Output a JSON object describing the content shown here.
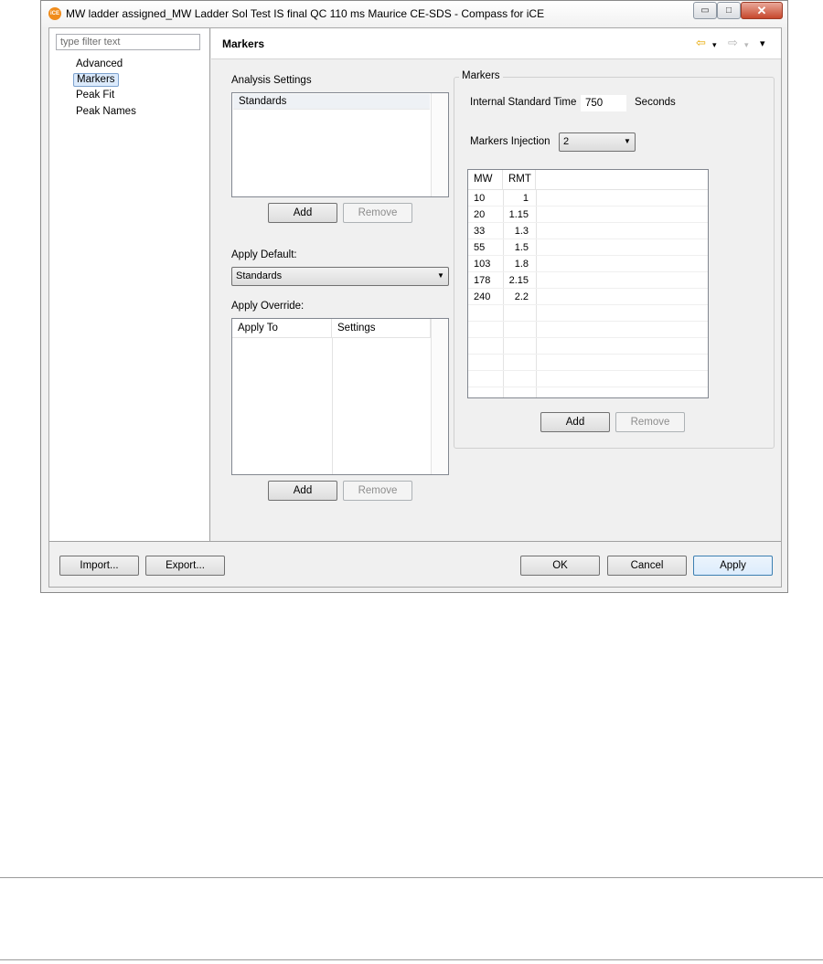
{
  "window": {
    "title": "MW ladder assigned_MW Ladder Sol Test IS final QC 110 ms Maurice CE-SDS - Compass for iCE",
    "app_icon_text": "iCE",
    "minimize": "▭",
    "maximize": "□",
    "close": "✕"
  },
  "sidebar": {
    "filter_placeholder": "type filter text",
    "items": [
      {
        "label": "Advanced",
        "selected": false
      },
      {
        "label": "Markers",
        "selected": true
      },
      {
        "label": "Peak Fit",
        "selected": false
      },
      {
        "label": "Peak Names",
        "selected": false
      }
    ]
  },
  "page": {
    "title": "Markers",
    "nav": {
      "back": "⇦",
      "forward": "⇨",
      "dropdown": "▾",
      "menu": "▾",
      "back_color": "#e8a800",
      "forward_color": "#b8b8b8"
    }
  },
  "analysis": {
    "label": "Analysis Settings",
    "items": [
      "Standards"
    ],
    "add": "Add",
    "remove": "Remove",
    "apply_default_label": "Apply Default:",
    "apply_default_value": "Standards",
    "apply_override_label": "Apply Override:",
    "override_columns": [
      "Apply To",
      "Settings"
    ],
    "override_add": "Add",
    "override_remove": "Remove"
  },
  "markers": {
    "group_label": "Markers",
    "internal_std_label": "Internal Standard Time",
    "internal_std_value": "750",
    "internal_std_unit": "Seconds",
    "injection_label": "Markers Injection",
    "injection_value": "2",
    "columns": [
      "MW",
      "RMT"
    ],
    "rows": [
      {
        "mw": "10",
        "rmt": "1"
      },
      {
        "mw": "20",
        "rmt": "1.15"
      },
      {
        "mw": "33",
        "rmt": "1.3"
      },
      {
        "mw": "55",
        "rmt": "1.5"
      },
      {
        "mw": "103",
        "rmt": "1.8"
      },
      {
        "mw": "178",
        "rmt": "2.15"
      },
      {
        "mw": "240",
        "rmt": "2.2"
      }
    ],
    "add": "Add",
    "remove": "Remove"
  },
  "footer": {
    "import": "Import...",
    "export": "Export...",
    "ok": "OK",
    "cancel": "Cancel",
    "apply": "Apply"
  }
}
